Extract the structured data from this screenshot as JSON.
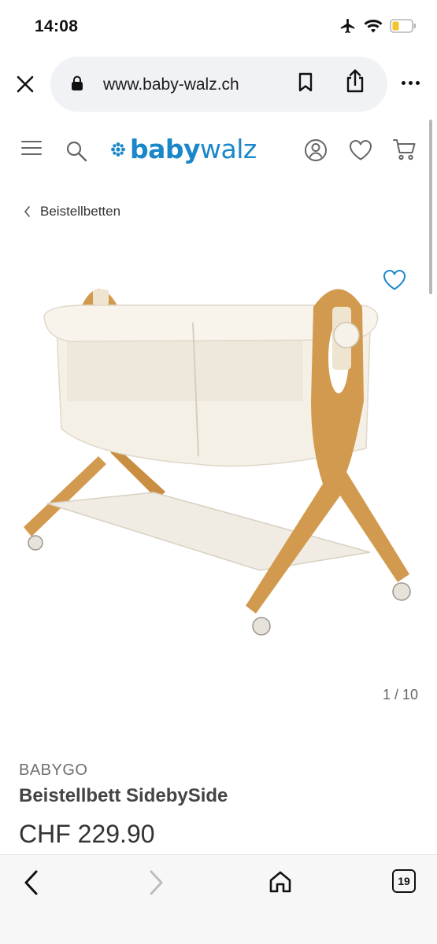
{
  "status": {
    "time": "14:08"
  },
  "browser": {
    "url": "www.baby-walz.ch"
  },
  "site": {
    "logo_prefix": "baby",
    "logo_suffix": "walz",
    "brand_color": "#1a87c9"
  },
  "breadcrumb": {
    "label": "Beistellbetten"
  },
  "gallery": {
    "counter": "1 / 10",
    "image_alt": "white baby bedside crib with wooden frame and wheels"
  },
  "product": {
    "brand": "BABYGO",
    "name": "Beistellbett SidebySide",
    "price": "CHF 229.90"
  },
  "tabs": {
    "count": "19"
  },
  "icons": {
    "close": "close-icon",
    "lock": "lock-icon",
    "bookmark": "bookmark-icon",
    "share": "share-icon",
    "more": "more-icon",
    "menu": "hamburger-icon",
    "search": "search-icon",
    "account": "account-icon",
    "wishlist": "heart-icon",
    "cart": "cart-icon",
    "back": "chevron-left-icon",
    "forward": "chevron-right-icon",
    "home": "home-icon"
  }
}
